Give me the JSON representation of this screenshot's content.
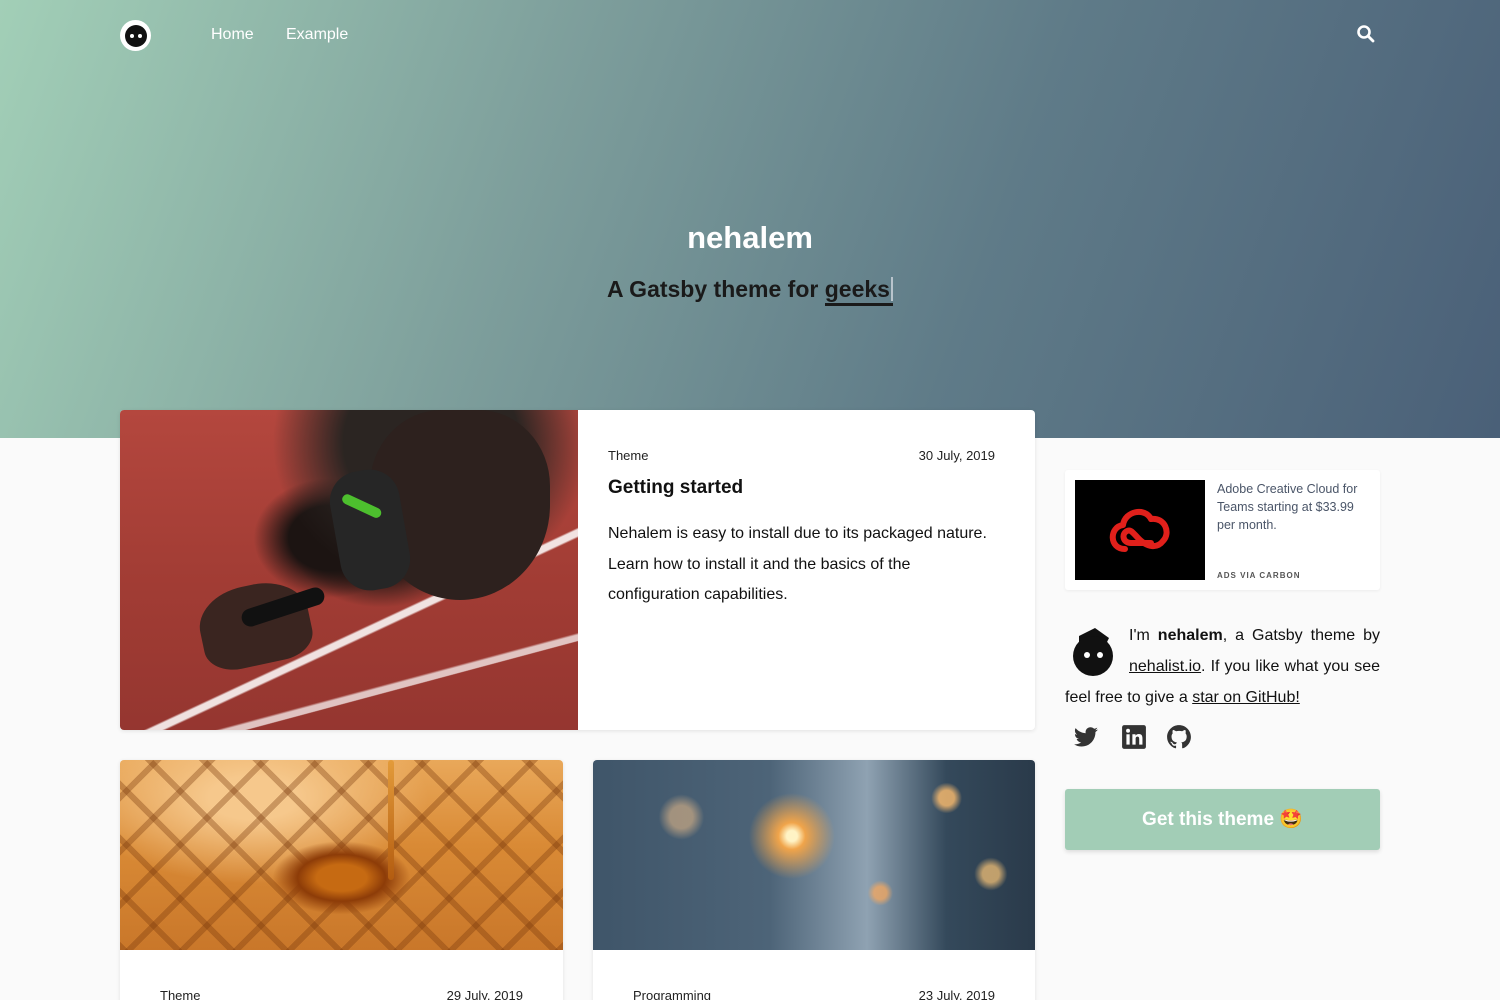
{
  "nav": {
    "home_label": "Home",
    "example_label": "Example",
    "logo_icon": "nehalem-logo-icon",
    "search_icon": "search-icon"
  },
  "hero": {
    "title": "nehalem",
    "subtitle_prefix": "A Gatsby theme for ",
    "subtitle_typed": "geeks"
  },
  "posts": [
    {
      "category": "Theme",
      "date": "30 July, 2019",
      "title": "Getting started",
      "excerpt": "Nehalem is easy to install due to its packaged nature. Learn how to install it and the basics of the configuration capabilities."
    },
    {
      "category": "Theme",
      "date": "29 July, 2019"
    },
    {
      "category": "Programming",
      "date": "23 July, 2019"
    }
  ],
  "ad": {
    "text": "Adobe Creative Cloud for Teams starting at $33.99 per month.",
    "via": "ADS VIA CARBON",
    "logo_icon": "adobe-cc-logo-icon",
    "logo_color": "#e0201b"
  },
  "bio": {
    "intro": "I'm ",
    "name": "nehalem",
    "mid": ", a Gatsby theme by ",
    "link1": "nehalist.io",
    "mid2": ". If you like what you see feel free to give a ",
    "link2": "star on GitHub!"
  },
  "socials": [
    "twitter-icon",
    "linkedin-icon",
    "github-icon"
  ],
  "cta": {
    "label": "Get this theme 🤩",
    "color": "#a2cdb6"
  },
  "colors": {
    "hero_start": "#a2cfb7",
    "hero_end": "#4a6078",
    "accent": "#a2cdb6"
  }
}
